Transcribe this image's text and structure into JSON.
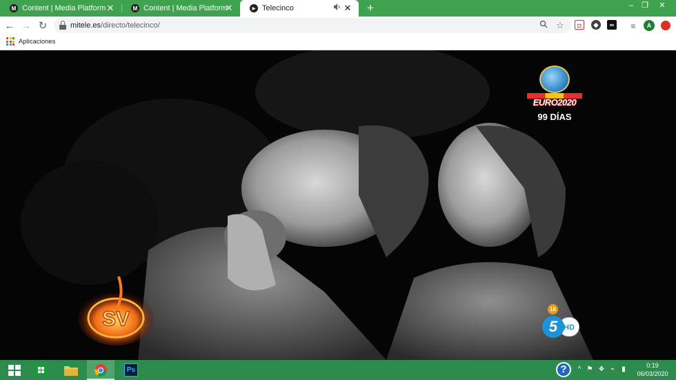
{
  "browser": {
    "tabs": [
      {
        "title": "Content | Media Platform",
        "favicon": "M",
        "active": false
      },
      {
        "title": "Content | Media Platform",
        "favicon": "M",
        "active": false
      },
      {
        "title": "Telecinco",
        "favicon": "▶",
        "active": true
      }
    ],
    "address": {
      "host": "mitele.es",
      "path": "/directo/telecinco/"
    },
    "bookmarks": {
      "apps_label": "Aplicaciones"
    },
    "avatar_letter": "A"
  },
  "video": {
    "overlay_euro": {
      "text": "EURO2020",
      "countdown": "99 DÍAS"
    },
    "show_logo": "SV",
    "age_rating": "16",
    "channel": {
      "number": "5",
      "hd": "HD"
    }
  },
  "taskbar": {
    "clock_time": "0:19",
    "clock_date": "06/03/2020",
    "photoshop_label": "Ps"
  },
  "colors": {
    "chrome_green": "#3ea24f",
    "taskbar_green": "#2e8b4e",
    "channel_blue": "#1a94d6"
  }
}
